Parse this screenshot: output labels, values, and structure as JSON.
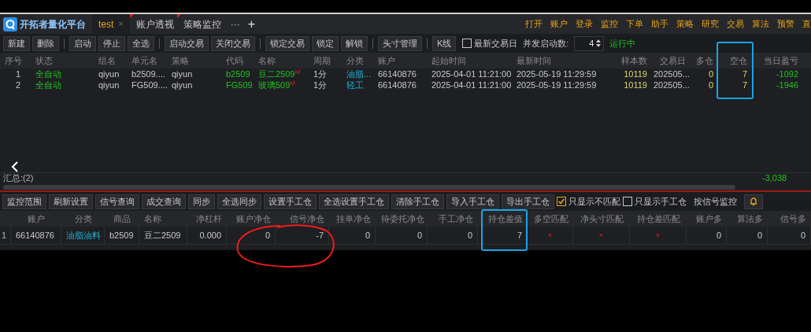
{
  "app": {
    "title": "开拓者量化平台"
  },
  "tabs": [
    {
      "label": "test",
      "selected": true,
      "flagged": false,
      "close": "×"
    },
    {
      "label": "账户透视",
      "selected": false,
      "flagged": true
    },
    {
      "label": "策略监控",
      "selected": false,
      "flagged": true
    }
  ],
  "tab_more": "···",
  "tab_add": "+",
  "menu": [
    "打开",
    "账户",
    "登录",
    "监控",
    "下单",
    "助手",
    "策略",
    "研究",
    "交易",
    "算法",
    "预警",
    "直"
  ],
  "toolbar": {
    "groups": [
      [
        "新建",
        "删除"
      ],
      [
        "启动",
        "停止",
        "全选"
      ],
      [
        "启动交易",
        "关闭交易"
      ],
      [
        "锁定交易",
        "锁定",
        "解锁"
      ],
      [
        "头寸管理"
      ],
      [
        "K线"
      ]
    ],
    "checkbox": {
      "label": "最新交易日",
      "checked": false
    },
    "concurrency": {
      "label": "并发启动数:",
      "value": "4"
    },
    "status": "运行中"
  },
  "strategy_table": {
    "columns": [
      "序号",
      "状态",
      "组名",
      "单元名",
      "策略",
      "代码",
      "名称",
      "周期",
      "分类",
      "账户",
      "起始时间",
      "最新时间",
      "样本数",
      "交易日",
      "多仓",
      "空仓",
      "当日盈亏"
    ],
    "rows": [
      {
        "cells": [
          "1",
          "全自动",
          "qiyun",
          "b2509....",
          "qiyun",
          "b2509",
          "豆二2509$^{M}$",
          "1分",
          "油脂...",
          "66140876",
          "2025-04-01 11:21:00",
          "2025-05-19 11:29:59",
          "10119",
          "202505...",
          "0",
          "7",
          "-1092"
        ]
      },
      {
        "cells": [
          "2",
          "全自动",
          "qiyun",
          "FG509....",
          "qiyun",
          "FG509",
          "玻璃509$^{M}$",
          "1分",
          "轻工",
          "66140876",
          "2025-04-01 11:21:00",
          "2025-05-19 11:29:59",
          "10119",
          "202505...",
          "0",
          "7",
          "-1946"
        ]
      }
    ]
  },
  "summary": {
    "label": "汇总:(2)",
    "total": "-3,038"
  },
  "monitor_toolbar": {
    "buttons": [
      "监控范围",
      "刷新设置",
      "信号查询",
      "成交查询",
      "同步",
      "全选同步",
      "设置手工仓",
      "全选设置手工仓",
      "清除手工仓",
      "导入手工仓",
      "导出手工仓"
    ],
    "checkboxes": [
      {
        "label": "只显示不匹配",
        "checked": true
      },
      {
        "label": "只显示手工仓",
        "checked": false
      }
    ],
    "mode": "按信号监控"
  },
  "monitor_table": {
    "columns": [
      "账户",
      "分类",
      "商品",
      "名称",
      "净杠杆",
      "账户净仓",
      "信号净仓",
      "挂单净仓",
      "待委托净仓",
      "手工净仓",
      "持仓差值",
      "多空匹配",
      "净头寸匹配",
      "持仓差匹配",
      "账户多",
      "算法多",
      "信号多"
    ],
    "rows": [
      {
        "index": "1",
        "cells": [
          "66140876",
          "油脂油料",
          "b2509",
          "豆二2509",
          "0.000",
          "0",
          "-7",
          "0",
          "0",
          "0",
          "7",
          "×",
          "×",
          "×",
          "0",
          "0",
          "0"
        ]
      }
    ]
  }
}
